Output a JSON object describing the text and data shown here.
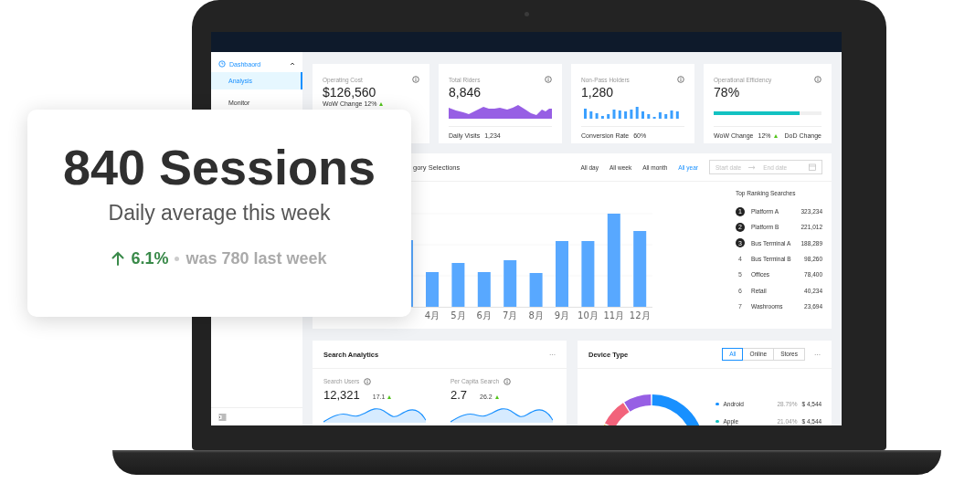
{
  "promo_card": {
    "headline": "840 Sessions",
    "subtitle": "Daily average this week",
    "change": "6.1%",
    "comparison": "was 780 last week"
  },
  "sidebar": {
    "menu": {
      "label": "Dashbaord",
      "expanded": true
    },
    "items": [
      {
        "label": "Analysis",
        "selected": true
      },
      {
        "label": "Monitor",
        "selected": false
      }
    ]
  },
  "stat_cards": [
    {
      "kind": "text",
      "title": "Operating Cost",
      "value": "$126,560",
      "footer": [
        {
          "label": "WoW Change 12%"
        }
      ]
    },
    {
      "kind": "area",
      "title": "Total Riders",
      "value": "8,846",
      "footer": [
        {
          "label": "Daily Visits",
          "value": "1,234"
        }
      ]
    },
    {
      "kind": "bars",
      "title": "Non-Pass Holders",
      "value": "1,280",
      "footer": [
        {
          "label": "Conversion Rate",
          "value": "60%"
        }
      ]
    },
    {
      "kind": "progress",
      "title": "Operational Efficiency",
      "value": "78%",
      "level": 0.8,
      "footer": [
        {
          "label": "WoW Change",
          "value": "12%"
        },
        {
          "label": "DoD Change"
        }
      ]
    }
  ],
  "chart_card": {
    "title": "gory Selections",
    "ranges": [
      {
        "label": "All day",
        "selected": false
      },
      {
        "label": "All week",
        "selected": false
      },
      {
        "label": "All month",
        "selected": false
      },
      {
        "label": "All year",
        "selected": true
      }
    ],
    "date_range": {
      "start_placeholder": "Start date",
      "end_placeholder": "End date"
    },
    "x_labels": [
      "4月",
      "5月",
      "6月",
      "7月",
      "8月",
      "9月",
      "10月",
      "11月",
      "12月"
    ],
    "ranking": {
      "title": "Top Ranking Searches",
      "rows": [
        {
          "rank": "1",
          "name": "Platform A",
          "value": "323,234",
          "highlighted": true
        },
        {
          "rank": "2",
          "name": "Platform B",
          "value": "221,012",
          "highlighted": true
        },
        {
          "rank": "3",
          "name": "Bus Terminal A",
          "value": "188,289",
          "highlighted": true
        },
        {
          "rank": "4",
          "name": "Bus Terminal B",
          "value": "98,260",
          "highlighted": false
        },
        {
          "rank": "5",
          "name": "Offices",
          "value": "78,400",
          "highlighted": false
        },
        {
          "rank": "6",
          "name": "Retail",
          "value": "40,234",
          "highlighted": false
        },
        {
          "rank": "7",
          "name": "Washrooms",
          "value": "23,694",
          "highlighted": false
        }
      ]
    }
  },
  "search_card": {
    "title": "Search Analytics",
    "more": "···",
    "metrics": [
      {
        "label": "Search Users",
        "value": "12,321",
        "change": "17.1"
      },
      {
        "label": "Per Capita Search",
        "value": "2.7",
        "change": "26.2"
      }
    ]
  },
  "device_card": {
    "title": "Device Type",
    "more": "···",
    "filters": [
      {
        "label": "All",
        "selected": true
      },
      {
        "label": "Online",
        "selected": false
      },
      {
        "label": "Stores",
        "selected": false
      }
    ],
    "legend": [
      {
        "name": "Android",
        "color": "#1890ff",
        "percent": "28.79%",
        "amount": "$ 4,544"
      },
      {
        "name": "Apple",
        "color": "#13c2c2",
        "percent": "21.04%",
        "amount": "$ 4,544"
      }
    ]
  }
}
